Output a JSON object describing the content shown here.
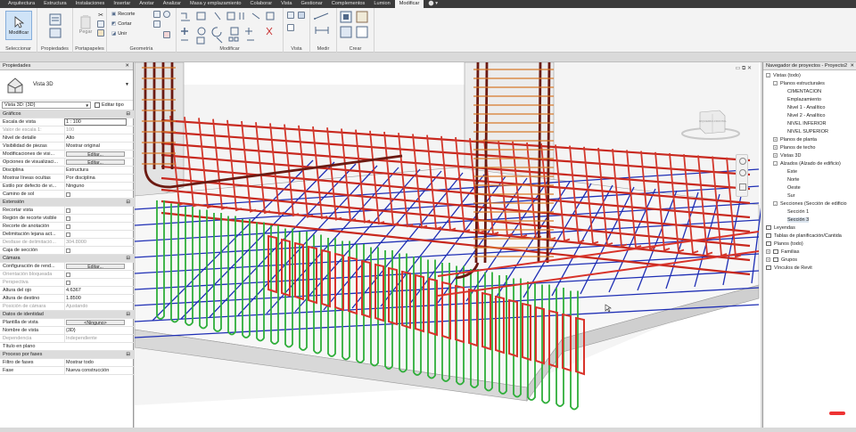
{
  "menu": {
    "tabs": [
      "Arquitectura",
      "Estructura",
      "Instalaciones",
      "Insertar",
      "Anotar",
      "Analizar",
      "Masa y emplazamiento",
      "Colaborar",
      "Vista",
      "Gestionar",
      "Complementos",
      "Lumion",
      "Modificar"
    ],
    "active": "Modificar"
  },
  "ribbon": {
    "modify_label": "Modificar",
    "select_label": "Seleccionar",
    "properties_label": "Propiedades",
    "paste_label": "Pegar",
    "clipboard_label": "Portapapeles",
    "cut_label": "Recorte",
    "join_label": "Unir",
    "cope_label": "Cortar",
    "geometry_label": "Geometría",
    "modify_group_label": "Modificar",
    "view_label": "Vista",
    "measure_label": "Medir",
    "create_label": "Crear"
  },
  "properties": {
    "title": "Propiedades",
    "type_name": "Vista 3D",
    "selector": "Vista 3D: {3D}",
    "edit_type": "Editar tipo",
    "rows": [
      {
        "k": "Gráficos",
        "v": "",
        "section": true
      },
      {
        "k": "Escala de vista",
        "v": "1 : 100",
        "input": true
      },
      {
        "k": "Valor de escala    1:",
        "v": "100",
        "dim": true
      },
      {
        "k": "Nivel de detalle",
        "v": "Alto"
      },
      {
        "k": "Visibilidad de piezas",
        "v": "Mostrar original"
      },
      {
        "k": "Modificaciones de visi...",
        "v": "Editar...",
        "button": true
      },
      {
        "k": "Opciones de visualizaci...",
        "v": "Editar...",
        "button": true
      },
      {
        "k": "Disciplina",
        "v": "Estructura"
      },
      {
        "k": "Mostrar líneas ocultas",
        "v": "Por disciplina"
      },
      {
        "k": "Estilo por defecto de vi...",
        "v": "Ninguno"
      },
      {
        "k": "Camino de sol",
        "v": "",
        "check": true
      },
      {
        "k": "Extensión",
        "v": "",
        "section": true
      },
      {
        "k": "Recortar vista",
        "v": "",
        "check": true
      },
      {
        "k": "Región de recorte visible",
        "v": "",
        "check": true
      },
      {
        "k": "Recorte de anotación",
        "v": "",
        "check": true
      },
      {
        "k": "Delimitación lejana act...",
        "v": "",
        "check": true
      },
      {
        "k": "Desfase de delimitació...",
        "v": "304.8000",
        "dim": true
      },
      {
        "k": "Caja de sección",
        "v": "",
        "check": true
      },
      {
        "k": "Cámara",
        "v": "",
        "section": true
      },
      {
        "k": "Configuración de rend...",
        "v": "Editar...",
        "button": true
      },
      {
        "k": "Orientación bloqueada",
        "v": "",
        "check": true,
        "dim": true
      },
      {
        "k": "Perspectiva",
        "v": "",
        "check": true,
        "dim": true
      },
      {
        "k": "Altura del ojo",
        "v": "4.6367"
      },
      {
        "k": "Altura de destino",
        "v": "1.8500"
      },
      {
        "k": "Posición de cámara",
        "v": "Ajustando",
        "dim": true
      },
      {
        "k": "Datos de identidad",
        "v": "",
        "section": true
      },
      {
        "k": "Plantilla de vista",
        "v": "<Ninguno>",
        "button": true
      },
      {
        "k": "Nombre de vista",
        "v": "{3D}"
      },
      {
        "k": "Dependencia",
        "v": "Independiente",
        "dim": true
      },
      {
        "k": "Título en plano",
        "v": ""
      },
      {
        "k": "Proceso por fases",
        "v": "",
        "section": true
      },
      {
        "k": "Filtro de fases",
        "v": "Mostrar todo"
      },
      {
        "k": "Fase",
        "v": "Nueva construcción"
      }
    ]
  },
  "viewcube": {
    "left": "IZQUIERDA",
    "front": "FRONTAL"
  },
  "navigator": {
    "title": "Navegador de proyectos - Proyecto2",
    "items": [
      {
        "label": "Vistas (todo)",
        "level": 0,
        "exp": "-"
      },
      {
        "label": "Planos estructurales",
        "level": 1,
        "exp": "-"
      },
      {
        "label": "CIMENTACION",
        "level": 2
      },
      {
        "label": "Emplazamiento",
        "level": 2
      },
      {
        "label": "Nivel 1 - Analítico",
        "level": 2
      },
      {
        "label": "Nivel 2 - Analítico",
        "level": 2
      },
      {
        "label": "NIVEL INFERIOR",
        "level": 2
      },
      {
        "label": "NIVEL SUPERIOR",
        "level": 2
      },
      {
        "label": "Planos de planta",
        "level": 1,
        "exp": "+"
      },
      {
        "label": "Planos de techo",
        "level": 1,
        "exp": "+"
      },
      {
        "label": "Vistas 3D",
        "level": 1,
        "exp": "+"
      },
      {
        "label": "Alzados (Alzado de edificio)",
        "level": 1,
        "exp": "-"
      },
      {
        "label": "Este",
        "level": 2
      },
      {
        "label": "Norte",
        "level": 2
      },
      {
        "label": "Oeste",
        "level": 2
      },
      {
        "label": "Sur",
        "level": 2
      },
      {
        "label": "Secciones (Sección de edificio",
        "level": 1,
        "exp": "-"
      },
      {
        "label": "Sección 1",
        "level": 2
      },
      {
        "label": "Sección 3",
        "level": 2,
        "selected": true
      },
      {
        "label": "Leyendas",
        "level": 0,
        "icon": true
      },
      {
        "label": "Tablas de planificación/Cantida",
        "level": 0,
        "icon": true
      },
      {
        "label": "Planos (todo)",
        "level": 0,
        "icon": true
      },
      {
        "label": "Familias",
        "level": 0,
        "exp": "+",
        "icon": true
      },
      {
        "label": "Grupos",
        "level": 0,
        "exp": "+",
        "icon": true
      },
      {
        "label": "Vínculos de Revit",
        "level": 0,
        "icon": true
      }
    ]
  },
  "colors": {
    "rebar_red": "#c8281e",
    "rebar_green": "#2fae3a",
    "rebar_blue": "#1f2fb5",
    "concrete": "#e6e6e6",
    "column_dark": "#5a1a14"
  }
}
